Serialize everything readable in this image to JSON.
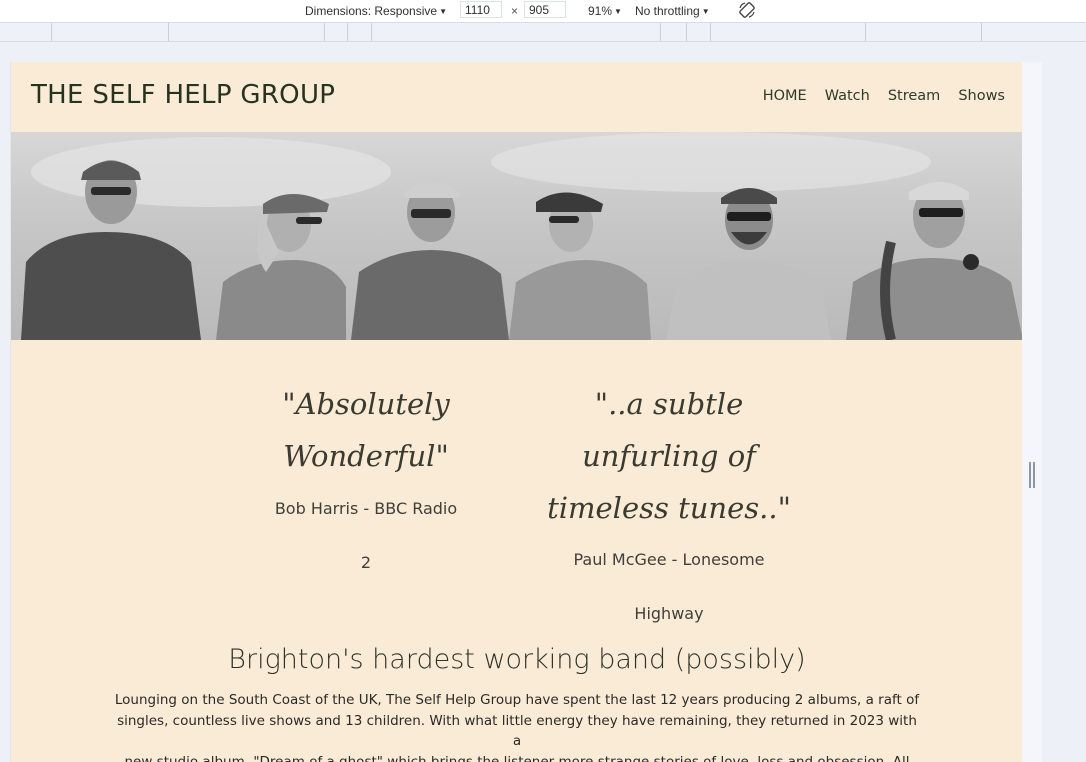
{
  "devtools": {
    "dimensions_label": "Dimensions: Responsive",
    "width_value": "1110",
    "times": "×",
    "height_value": "905",
    "zoom": "91%",
    "throttling": "No throttling",
    "rotate_icon": "rotate-icon"
  },
  "site": {
    "title": "THE SELF HELP GROUP",
    "nav": [
      "HOME",
      "Watch",
      "Stream",
      "Shows"
    ]
  },
  "quotes": [
    {
      "lines": [
        "\"Absolutely",
        "Wonderful\""
      ],
      "attribution": [
        "Bob Harris - BBC Radio",
        "2"
      ]
    },
    {
      "lines": [
        "\"..a subtle",
        "unfurling of",
        "timeless tunes..\""
      ],
      "attribution": [
        "Paul McGee - Lonesome",
        "Highway"
      ]
    }
  ],
  "headline": "Brighton's hardest working band (possibly)",
  "body_lines": [
    "Lounging on the South Coast of the UK, The Self Help Group have spent the last 12 years producing 2 albums, a raft of",
    "singles, countless live shows and 13 children. With what little energy they have remaining, they returned in 2023 with a",
    "new studio album, \"Dream of a ghost\" which brings the listener more strange stories of love, loss and obsession. All"
  ]
}
